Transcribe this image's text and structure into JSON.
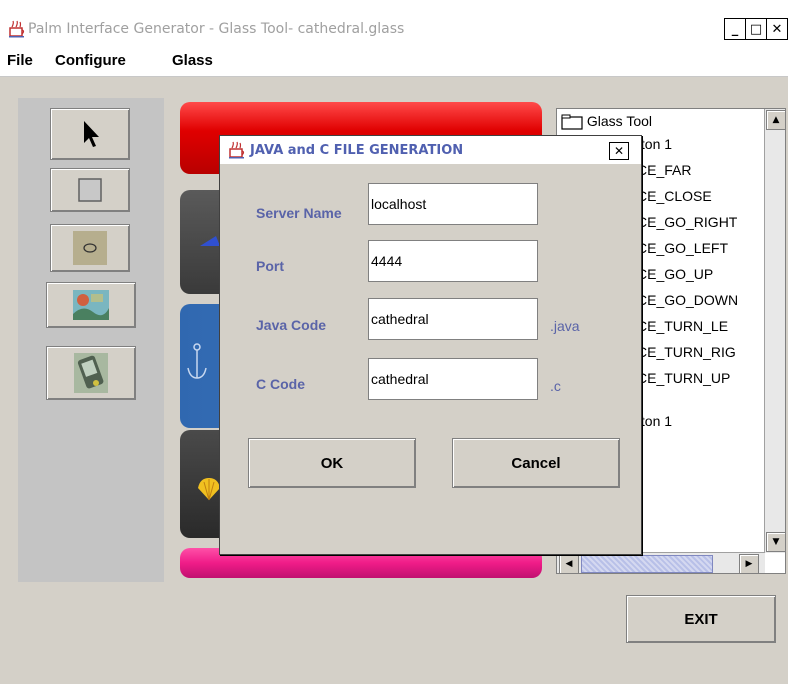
{
  "window": {
    "title": "Palm Interface Generator - Glass Tool- cathedral.glass",
    "minimize": "_",
    "maximize": "□",
    "close": "✕"
  },
  "menu": [
    "File",
    "Configure",
    "Glass"
  ],
  "tree": {
    "root": "Glass Tool",
    "items": [
      "tton 1",
      "CE_FAR",
      "CE_CLOSE",
      "CE_GO_RIGHT",
      "CE_GO_LEFT",
      "CE_GO_UP",
      "CE_GO_DOWN",
      "CE_TURN_LE",
      "CE_TURN_RIG",
      "CE_TURN_UP",
      "tton 1"
    ]
  },
  "exit_label": "EXIT",
  "dialog": {
    "title": "JAVA and C FILE GENERATION",
    "close": "✕",
    "fields": {
      "server_name": {
        "label": "Server Name",
        "value": "localhost"
      },
      "port": {
        "label": "Port",
        "value": "4444"
      },
      "java_code": {
        "label": "Java Code",
        "value": "cathedral",
        "suffix": ".java"
      },
      "c_code": {
        "label": "C Code",
        "value": "cathedral",
        "suffix": ".c"
      }
    },
    "ok_label": "OK",
    "cancel_label": "Cancel"
  },
  "colors": {
    "label": "#5a64a8",
    "red_button": "#ee1111",
    "pink_button": "#f01c88",
    "blue_button": "#3d73b8",
    "dark_button": "#4a4a4a"
  }
}
